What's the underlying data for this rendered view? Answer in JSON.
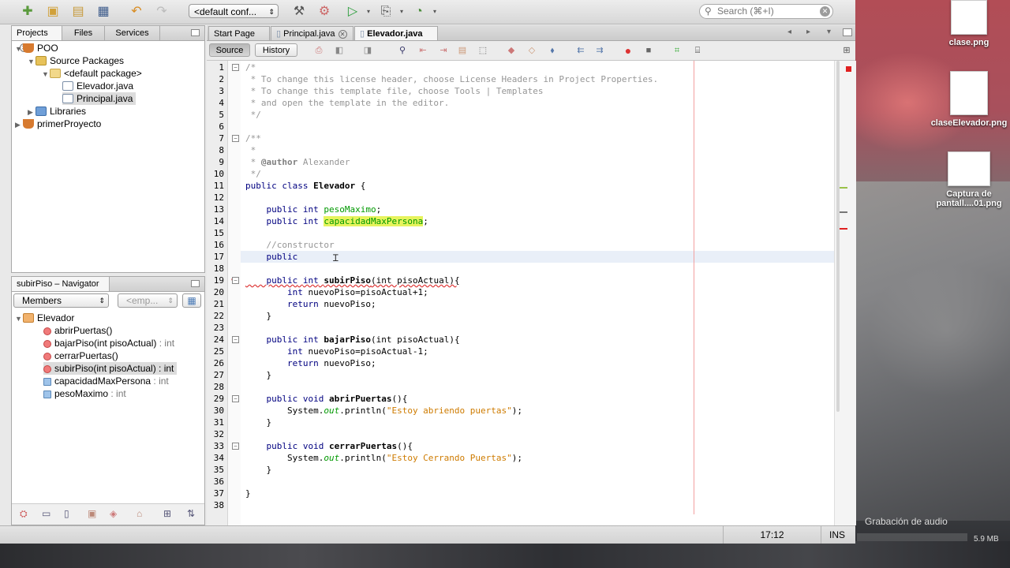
{
  "toolbar": {
    "config_value": "<default conf...",
    "search_placeholder": "Search (⌘+I)"
  },
  "projects_panel": {
    "tabs": [
      "Projects",
      "Files",
      "Services"
    ],
    "tree": [
      {
        "label": "POO"
      },
      {
        "label": "Source Packages"
      },
      {
        "label": "<default package>"
      },
      {
        "label": "Elevador.java"
      },
      {
        "label": "Principal.java"
      },
      {
        "label": "Libraries"
      },
      {
        "label": "primerProyecto"
      }
    ]
  },
  "navigator": {
    "title": "subirPiso – Navigator",
    "members_combo": "Members",
    "filter_combo": "<emp...",
    "class_name": "Elevador",
    "members": [
      {
        "name": "abrirPuertas()",
        "type": ""
      },
      {
        "name": "bajarPiso(int pisoActual)",
        "type": " : int"
      },
      {
        "name": "cerrarPuertas()",
        "type": ""
      },
      {
        "name": "subirPiso(int pisoActual)",
        "type": " : int"
      },
      {
        "name": "capacidadMaxPersona",
        "type": " : int"
      },
      {
        "name": "pesoMaximo",
        "type": " : int"
      }
    ]
  },
  "editor": {
    "tabs": [
      "Start Page",
      "Principal.java",
      "Elevador.java"
    ],
    "source_label": "Source",
    "history_label": "History",
    "line_numbers": [
      "1",
      "2",
      "3",
      "4",
      "5",
      "6",
      "7",
      "8",
      "9",
      "10",
      "11",
      "12",
      "13",
      "14",
      "15",
      "16",
      "17",
      "18",
      "19",
      "20",
      "21",
      "22",
      "23",
      "24",
      "25",
      "26",
      "27",
      "28",
      "29",
      "30",
      "31",
      "32",
      "33",
      "34",
      "35",
      "36",
      "37",
      "38"
    ],
    "code": {
      "l1": "/*",
      "l2": " * To change this license header, choose License Headers in Project Properties.",
      "l3": " * To change this template file, choose Tools | Templates",
      "l4": " * and open the template in the editor.",
      "l5": " */",
      "l7": "/**",
      "l8": " *",
      "l9a": " * ",
      "l9b": "@author",
      "l9c": " Alexander",
      "l10": " */",
      "public": "public",
      "class": "class",
      "int": "int",
      "void": "void",
      "return": "return",
      "class_name": "Elevador",
      "brace_open": " {",
      "f1": "pesoMaximo",
      "f2": "capacidadMaxPersona",
      "semi": ";",
      "l16": "//constructor",
      "m1": "subirPiso",
      "m2": "bajarPiso",
      "m3": "abrirPuertas",
      "m4": "cerrarPuertas",
      "param": "(int pisoActual){",
      "l20": " nuevoPiso=pisoActual+1;",
      "l25": " nuevoPiso=pisoActual-1;",
      "ret": " nuevoPiso;",
      "paren": "(){",
      "sys": "System.",
      "out": "out",
      "println": ".println(",
      "s1": "\"Estoy abriendo puertas\"",
      "s2": "\"Estoy Cerrando Puertas\"",
      "close": ");",
      "brace_close": "}"
    }
  },
  "status": {
    "position": "17:12",
    "mode": "INS"
  },
  "desktop": {
    "files": [
      "clase.png",
      "claseElevador.png",
      "Captura de pantall....01.png"
    ],
    "audio_label": "Grabación de audio",
    "audio_size": "5.9 MB"
  }
}
